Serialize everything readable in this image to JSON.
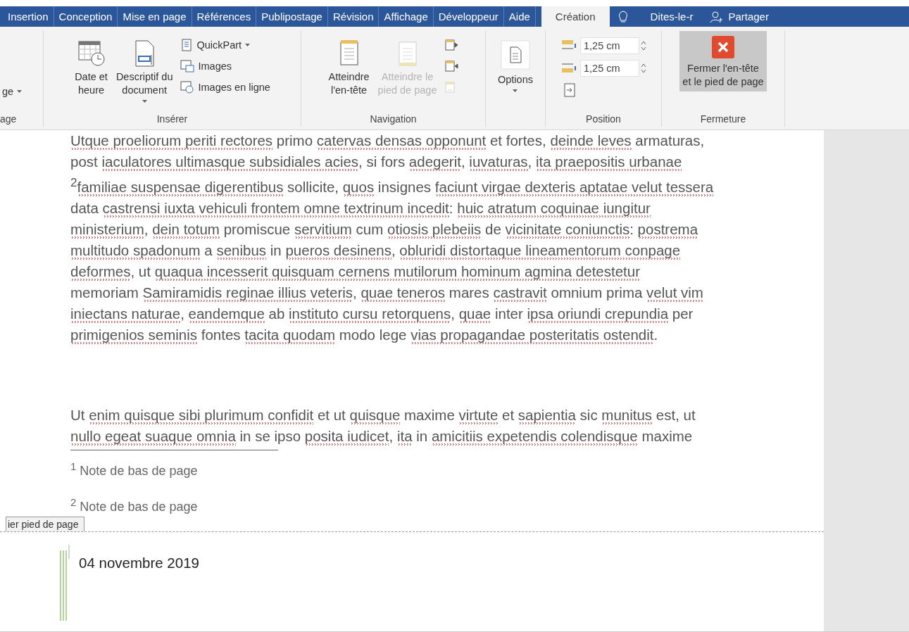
{
  "ribbon_tabs": [
    {
      "label": "Insertion",
      "selected": false
    },
    {
      "label": "Conception",
      "selected": false
    },
    {
      "label": "Mise en page",
      "selected": false
    },
    {
      "label": "Références",
      "selected": false
    },
    {
      "label": "Publipostage",
      "selected": false
    },
    {
      "label": "Révision",
      "selected": false
    },
    {
      "label": "Affichage",
      "selected": false
    },
    {
      "label": "Développeur",
      "selected": false
    },
    {
      "label": "Aide",
      "selected": false
    },
    {
      "label": "Création",
      "selected": true
    }
  ],
  "tell_me": {
    "label": "Dites-le-r"
  },
  "share": {
    "label": "Partager"
  },
  "ribbon_groups": [
    {
      "label": "age",
      "columns": [
        [
          {
            "kind": "small",
            "label": "ge",
            "dropdown": true,
            "disabled": false,
            "hovered": false
          }
        ]
      ]
    },
    {
      "label": "Insérer",
      "columns": [
        [
          {
            "kind": "large",
            "label": "Date et\nheure",
            "dropdown": false,
            "disabled": false,
            "hovered": false
          }
        ],
        [
          {
            "kind": "large",
            "label": "Descriptif du\ndocument",
            "dropdown": true,
            "disabled": false,
            "hovered": false
          }
        ],
        [
          {
            "kind": "small",
            "label": "QuickPart",
            "dropdown": true,
            "disabled": false,
            "hovered": false
          },
          {
            "kind": "small",
            "label": "Images",
            "dropdown": false,
            "disabled": false,
            "hovered": false
          },
          {
            "kind": "small",
            "label": "Images en ligne",
            "dropdown": false,
            "disabled": false,
            "hovered": false
          }
        ]
      ]
    },
    {
      "label": "Navigation",
      "columns": [
        [
          {
            "kind": "large",
            "label": "Atteindre\nl'en-tête",
            "dropdown": false,
            "disabled": false,
            "hovered": false
          }
        ],
        [
          {
            "kind": "large",
            "label": "Atteindre le\npied de page",
            "dropdown": false,
            "disabled": true,
            "hovered": false
          }
        ],
        [
          {
            "kind": "icon",
            "disabled": false,
            "hovered": false
          },
          {
            "kind": "icon",
            "disabled": false,
            "hovered": false
          },
          {
            "kind": "icon",
            "disabled": true,
            "hovered": false
          }
        ]
      ]
    },
    {
      "columns": [
        [
          {
            "kind": "large",
            "label": "Options",
            "dropdown": true,
            "disabled": false,
            "hovered": false
          }
        ]
      ]
    },
    {
      "label": "Position",
      "columns": [
        [
          {
            "kind": "spinner",
            "value": "1,25 cm"
          },
          {
            "kind": "spinner",
            "value": "1,25 cm"
          },
          {
            "kind": "icon",
            "disabled": false,
            "hovered": false
          }
        ]
      ]
    },
    {
      "label": "Fermeture",
      "columns": [
        [
          {
            "kind": "large",
            "label": "Fermer l'en-tête\net le pied de page",
            "dropdown": false,
            "disabled": false,
            "hovered": true
          }
        ]
      ]
    }
  ],
  "document": {
    "paragraphs": [
      [
        [
          {
            "text": "Utque proeliorum periti rectores",
            "misspelled": true
          },
          {
            "text": " primo ",
            "misspelled": false
          },
          {
            "text": "catervas densas opponunt",
            "misspelled": true
          },
          {
            "text": " et fortes, ",
            "misspelled": false
          },
          {
            "text": "deinde leves",
            "misspelled": true
          },
          {
            "text": " armaturas,",
            "misspelled": false
          }
        ],
        [
          {
            "text": "post ",
            "misspelled": false
          },
          {
            "text": "iaculatores ultimasque subsidiales acies",
            "misspelled": true
          },
          {
            "text": ", si fors ",
            "misspelled": false
          },
          {
            "text": "adegerit",
            "misspelled": true
          },
          {
            "text": ", ",
            "misspelled": false
          },
          {
            "text": "iuvaturas",
            "misspelled": true
          },
          {
            "text": ", ",
            "misspelled": false
          },
          {
            "text": "ita praepositis urbanae",
            "misspelled": true
          }
        ],
        [
          {
            "text": "$^{2}$",
            "misspelled": false
          },
          {
            "text": "familiae suspensae digerentibus",
            "misspelled": true
          },
          {
            "text": " sollicite, ",
            "misspelled": false
          },
          {
            "text": "quos",
            "misspelled": true
          },
          {
            "text": " insignes ",
            "misspelled": false
          },
          {
            "text": "faciunt virgae dexteris aptatae velut tessera",
            "misspelled": true
          }
        ],
        [
          {
            "text": "data ",
            "misspelled": false
          },
          {
            "text": "castrensi iuxta vehiculi frontem omne textrinum incedit",
            "misspelled": true
          },
          {
            "text": ": ",
            "misspelled": false
          },
          {
            "text": "huic atratum coquinae iungitur",
            "misspelled": true
          }
        ],
        [
          {
            "text": "ministerium",
            "misspelled": true
          },
          {
            "text": ", ",
            "misspelled": false
          },
          {
            "text": "dein totum",
            "misspelled": true
          },
          {
            "text": " promiscue ",
            "misspelled": false
          },
          {
            "text": "servitium",
            "misspelled": true
          },
          {
            "text": " cum ",
            "misspelled": false
          },
          {
            "text": "otiosis plebeiis",
            "misspelled": true
          },
          {
            "text": " de ",
            "misspelled": false
          },
          {
            "text": "vicinitate coniunctis",
            "misspelled": true
          },
          {
            "text": ": ",
            "misspelled": false
          },
          {
            "text": "postrema",
            "misspelled": true
          }
        ],
        [
          {
            "text": "multitudo spadonum",
            "misspelled": true
          },
          {
            "text": " a ",
            "misspelled": false
          },
          {
            "text": "senibus",
            "misspelled": true
          },
          {
            "text": " in ",
            "misspelled": false
          },
          {
            "text": "pueros desinens",
            "misspelled": true
          },
          {
            "text": ", ",
            "misspelled": false
          },
          {
            "text": "obluridi distortaque lineamentorum conpage",
            "misspelled": true
          }
        ],
        [
          {
            "text": "deformes",
            "misspelled": true
          },
          {
            "text": ", ut ",
            "misspelled": false
          },
          {
            "text": "quaqua incesserit quisquam cernens mutilorum hominum agmina detestetur",
            "misspelled": true
          }
        ],
        [
          {
            "text": "memoriam ",
            "misspelled": false
          },
          {
            "text": "Samiramidis reginae illius veteris",
            "misspelled": true
          },
          {
            "text": ", ",
            "misspelled": false
          },
          {
            "text": "quae teneros",
            "misspelled": true
          },
          {
            "text": " mares ",
            "misspelled": false
          },
          {
            "text": "castravit",
            "misspelled": true
          },
          {
            "text": " omnium prima ",
            "misspelled": false
          },
          {
            "text": "velut vim",
            "misspelled": true
          }
        ],
        [
          {
            "text": "iniectans naturae",
            "misspelled": true
          },
          {
            "text": ", ",
            "misspelled": false
          },
          {
            "text": "eandemque",
            "misspelled": true
          },
          {
            "text": " ab ",
            "misspelled": false
          },
          {
            "text": "instituto cursu retorquens",
            "misspelled": true
          },
          {
            "text": ", ",
            "misspelled": false
          },
          {
            "text": "quae",
            "misspelled": true
          },
          {
            "text": " inter ",
            "misspelled": false
          },
          {
            "text": "ipsa oriundi crepundia",
            "misspelled": true
          },
          {
            "text": " per",
            "misspelled": false
          }
        ],
        [
          {
            "text": "primigenios seminis",
            "misspelled": true
          },
          {
            "text": " fontes ",
            "misspelled": false
          },
          {
            "text": "tacita quodam",
            "misspelled": true
          },
          {
            "text": " modo lege ",
            "misspelled": false
          },
          {
            "text": "vias propagandae posteritatis ostendit",
            "misspelled": true
          },
          {
            "text": ".",
            "misspelled": false
          }
        ]
      ],
      [
        [
          {
            "text": "Ut ",
            "misspelled": false
          },
          {
            "text": "enim quisque sibi plurimum confidit",
            "misspelled": true
          },
          {
            "text": " et ut ",
            "misspelled": false
          },
          {
            "text": "quisque",
            "misspelled": true
          },
          {
            "text": " maxime ",
            "misspelled": false
          },
          {
            "text": "virtute",
            "misspelled": true
          },
          {
            "text": " et ",
            "misspelled": false
          },
          {
            "text": "sapientia",
            "misspelled": true
          },
          {
            "text": " sic ",
            "misspelled": false
          },
          {
            "text": "munitus",
            "misspelled": true
          },
          {
            "text": " est, ut",
            "misspelled": false
          }
        ],
        [
          {
            "text": "nullo egeat suaque omnia",
            "misspelled": true
          },
          {
            "text": " in se ipso ",
            "misspelled": false
          },
          {
            "text": "posita iudicet",
            "misspelled": true
          },
          {
            "text": ", ",
            "misspelled": false
          },
          {
            "text": "ita",
            "misspelled": true
          },
          {
            "text": " in ",
            "misspelled": false
          },
          {
            "text": "amicitiis expetendis colendisque",
            "misspelled": true
          },
          {
            "text": " maxime",
            "misspelled": false
          }
        ]
      ]
    ],
    "footnotes": [
      "$^{1}$ Note de bas de page",
      "$^{2}$ Note de bas de page"
    ],
    "footer_tag": "ier pied de page",
    "footer_text": "04 novembre 2019"
  }
}
